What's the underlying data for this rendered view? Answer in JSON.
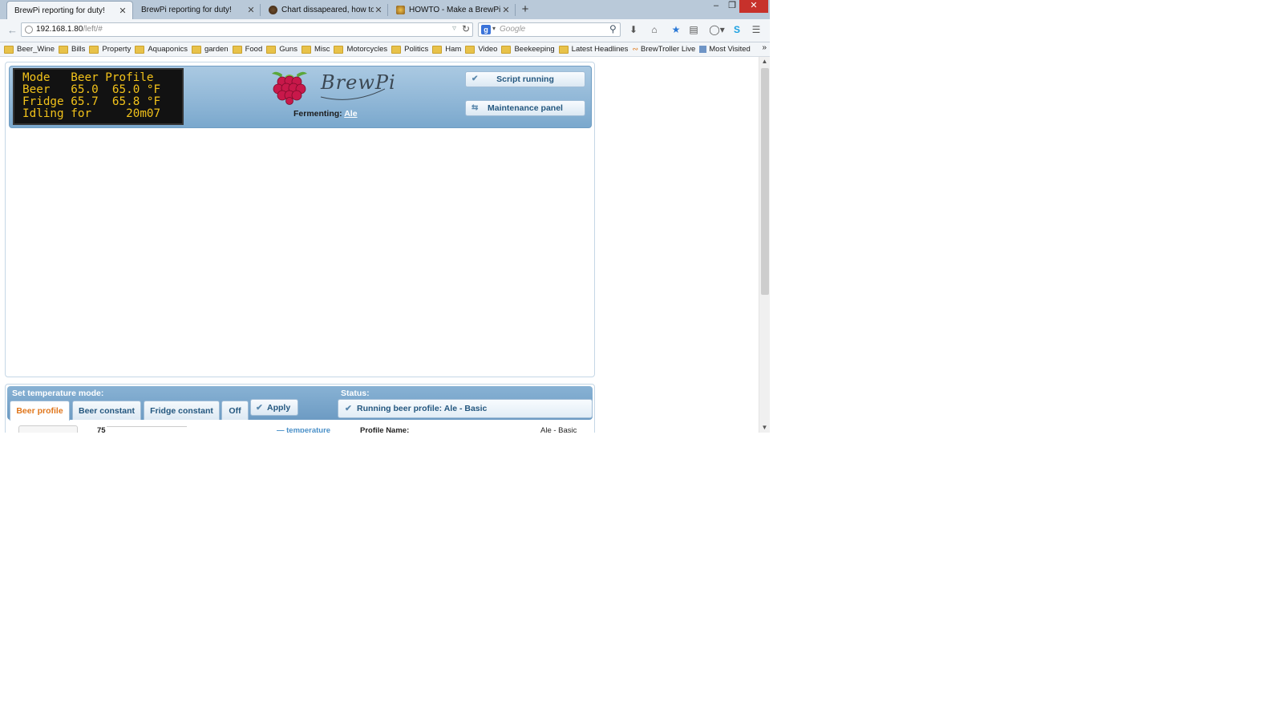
{
  "browser": {
    "tabs": [
      {
        "title": "BrewPi reporting for duty!",
        "active": true
      },
      {
        "title": "BrewPi reporting for duty!",
        "active": false
      },
      {
        "title": "Chart dissapeared, how to ...",
        "active": false
      },
      {
        "title": "HOWTO - Make a BrewPi F...",
        "active": false
      }
    ],
    "tab_close": "✕",
    "new_tab": "+",
    "window_controls": {
      "minimize": "–",
      "restore": "❐",
      "close": "✕"
    },
    "url_host": "192.168.1.80",
    "url_path": "/left/#",
    "search_engine_icon": "g",
    "search_placeholder": "Google",
    "bookmarks": [
      {
        "label": "Beer_Wine",
        "icon": "folder"
      },
      {
        "label": "Bills",
        "icon": "folder"
      },
      {
        "label": "Property",
        "icon": "folder"
      },
      {
        "label": "Aquaponics",
        "icon": "folder"
      },
      {
        "label": "garden",
        "icon": "folder"
      },
      {
        "label": "Food",
        "icon": "folder"
      },
      {
        "label": "Guns",
        "icon": "folder"
      },
      {
        "label": "Misc",
        "icon": "folder"
      },
      {
        "label": "Motorcycles",
        "icon": "folder"
      },
      {
        "label": "Politics",
        "icon": "folder"
      },
      {
        "label": "Ham",
        "icon": "folder"
      },
      {
        "label": "Video",
        "icon": "folder"
      },
      {
        "label": "Beekeeping",
        "icon": "folder"
      },
      {
        "label": "Latest Headlines",
        "icon": "folder"
      },
      {
        "label": "BrewTroller Live",
        "icon": "feed"
      },
      {
        "label": "Most Visited",
        "icon": "page"
      }
    ]
  },
  "brewpi": {
    "lcd_lines": [
      "Mode   Beer Profile",
      "Beer   65.0  65.0 °F",
      "Fridge 65.7  65.8 °F",
      "Idling for     20m07"
    ],
    "logo_text": "BrewPi",
    "fermenting_label": "Fermenting:",
    "fermenting_beer": "Ale",
    "script_status_button": "Script running",
    "maintenance_button": "Maintenance panel",
    "set_mode_label": "Set temperature mode:",
    "mode_tabs": [
      "Beer profile",
      "Beer constant",
      "Fridge constant",
      "Off"
    ],
    "active_mode": "Beer profile",
    "apply_button": "Apply",
    "status_label": "Status:",
    "status_text": "Running beer profile: Ale - Basic",
    "peek": {
      "axis_value": "75",
      "legend_text": "— temperature",
      "profile_name_label": "Profile Name:",
      "profile_name_value": "Ale - Basic"
    }
  },
  "colors": {
    "header_blue": "#7aa8cd",
    "lcd_text": "#f2c21a",
    "active_tab_text": "#e0761b",
    "button_text": "#24577f"
  }
}
